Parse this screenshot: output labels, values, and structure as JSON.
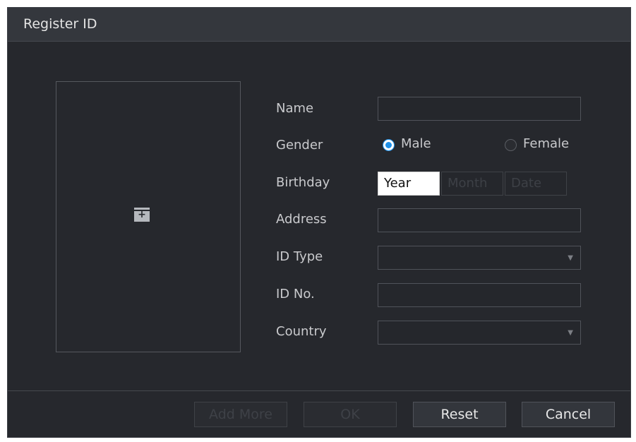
{
  "dialog": {
    "title": "Register ID"
  },
  "photo": {
    "add_icon": "add-photo-icon"
  },
  "form": {
    "name": {
      "label": "Name",
      "value": ""
    },
    "gender": {
      "label": "Gender",
      "options": [
        "Male",
        "Female"
      ],
      "selected": "Male"
    },
    "birthday": {
      "label": "Birthday",
      "year": "Year",
      "month": "Month",
      "date": "Date"
    },
    "address": {
      "label": "Address",
      "value": ""
    },
    "id_type": {
      "label": "ID Type",
      "value": ""
    },
    "id_no": {
      "label": "ID No.",
      "value": ""
    },
    "country": {
      "label": "Country",
      "value": ""
    }
  },
  "buttons": {
    "add_more": "Add More",
    "ok": "OK",
    "reset": "Reset",
    "cancel": "Cancel"
  },
  "colors": {
    "accent": "#1e90e8",
    "dialog_bg": "#26282d",
    "titlebar_bg": "#34373d"
  }
}
